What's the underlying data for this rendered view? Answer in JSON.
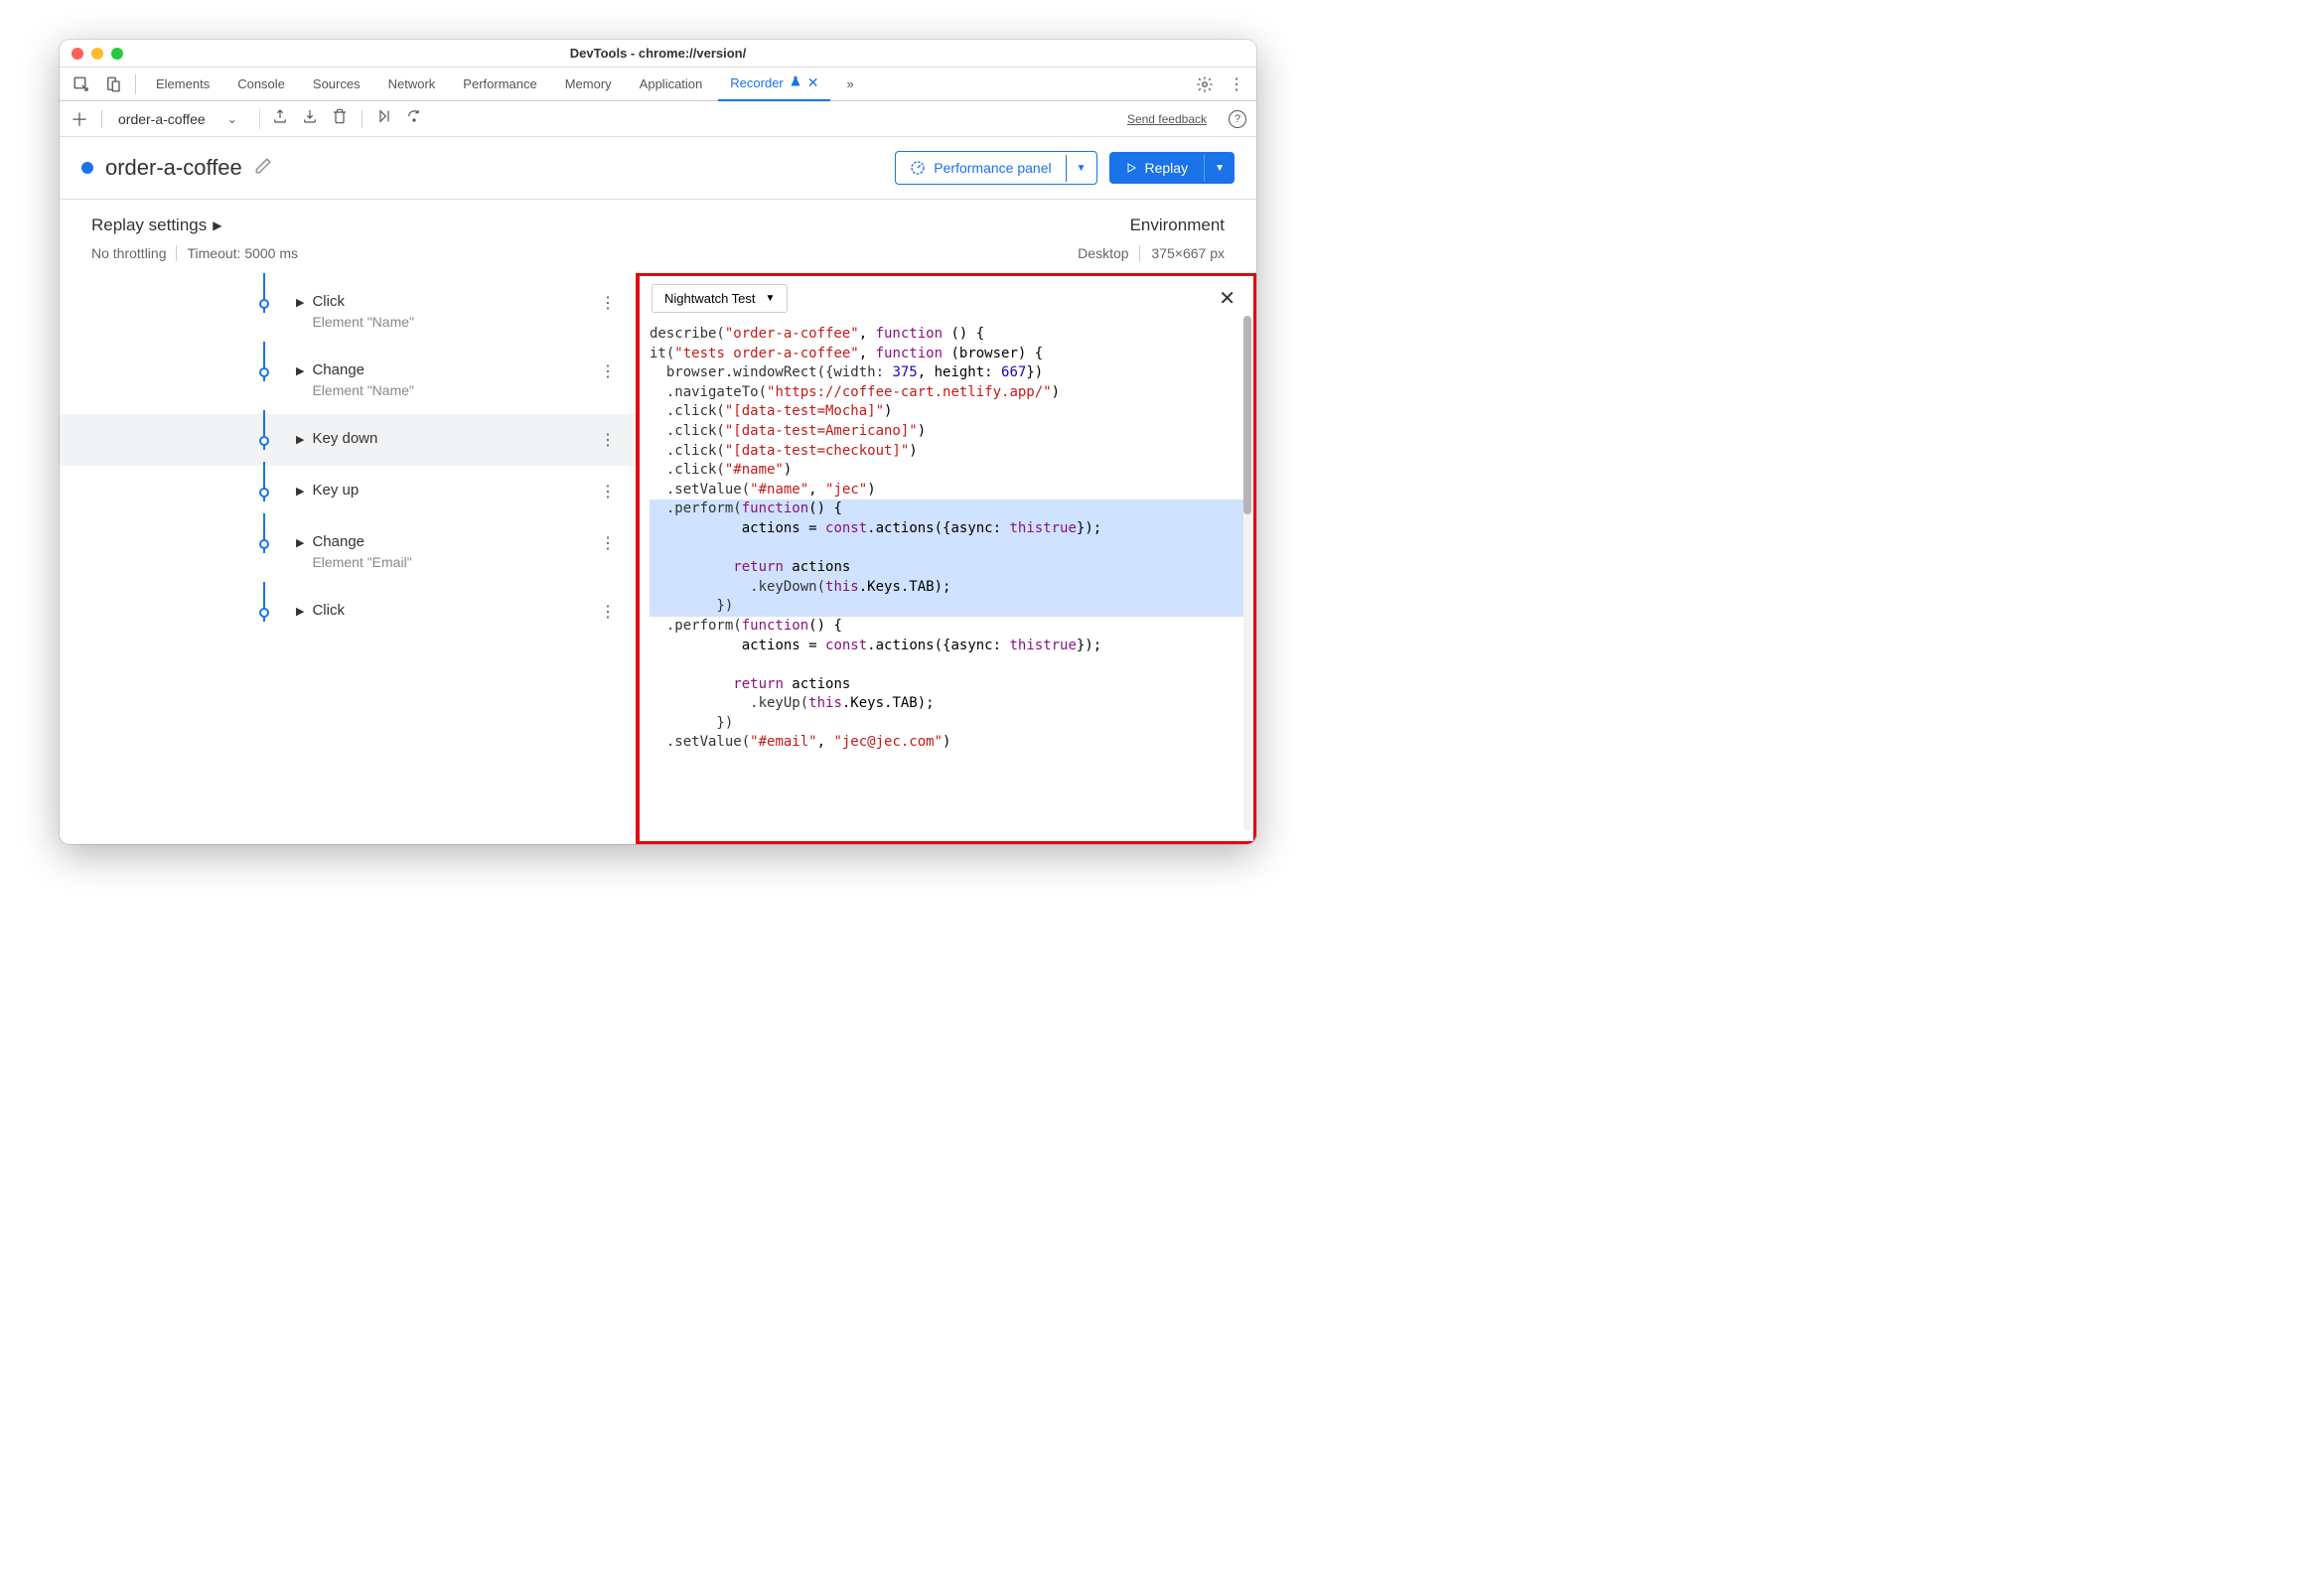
{
  "window": {
    "title": "DevTools - chrome://version/"
  },
  "tabs": {
    "items": [
      "Elements",
      "Console",
      "Sources",
      "Network",
      "Performance",
      "Memory",
      "Application",
      "Recorder"
    ],
    "active": "Recorder"
  },
  "toolbar": {
    "recording_name": "order-a-coffee",
    "feedback": "Send feedback"
  },
  "header": {
    "title": "order-a-coffee",
    "perf_button": "Performance panel",
    "replay_button": "Replay"
  },
  "settings": {
    "title": "Replay settings",
    "throttling": "No throttling",
    "timeout": "Timeout: 5000 ms",
    "env_title": "Environment",
    "env_device": "Desktop",
    "env_dims": "375×667 px"
  },
  "steps": [
    {
      "title": "Click",
      "sub": "Element \"Name\""
    },
    {
      "title": "Change",
      "sub": "Element \"Name\""
    },
    {
      "title": "Key down",
      "sub": ""
    },
    {
      "title": "Key up",
      "sub": ""
    },
    {
      "title": "Change",
      "sub": "Element \"Email\""
    },
    {
      "title": "Click",
      "sub": ""
    }
  ],
  "export": {
    "format": "Nightwatch Test"
  },
  "code": {
    "lines": [
      {
        "t": "describe(",
        "s": "\"order-a-coffee\"",
        "r": ", ",
        "k": "function",
        "e": " () {"
      },
      {
        "t": "it(",
        "s": "\"tests order-a-coffee\"",
        "r": ", ",
        "k": "function",
        "e": " (browser) {"
      },
      {
        "t": "  browser.windowRect({width: ",
        "n1": "375",
        "m": ", height: ",
        "n2": "667",
        "e": "})"
      },
      {
        "t": "  .navigateTo(",
        "s": "\"https://coffee-cart.netlify.app/\"",
        "e": ")"
      },
      {
        "t": "  .click(",
        "s": "\"[data-test=Mocha]\"",
        "e": ")"
      },
      {
        "t": "  .click(",
        "s": "\"[data-test=Americano]\"",
        "e": ")"
      },
      {
        "t": "  .click(",
        "s": "\"[data-test=checkout]\"",
        "e": ")"
      },
      {
        "t": "  .click(",
        "s": "\"#name\"",
        "e": ")"
      },
      {
        "t": "  .setValue(",
        "s": "\"#name\"",
        "m": ", ",
        "s2": "\"jec\"",
        "e": ")"
      },
      {
        "hl": true,
        "t": "  .perform(",
        "k": "function",
        "e": "() {"
      },
      {
        "hl": true,
        "t": "          ",
        "k": "const",
        "m": " actions = ",
        "k2": "this",
        "e": ".actions({async: ",
        "k3": "true",
        "e2": "});"
      },
      {
        "hl": true,
        "t": ""
      },
      {
        "hl": true,
        "t": "          ",
        "k": "return",
        "e": " actions"
      },
      {
        "hl": true,
        "t": "            .keyDown(",
        "k": "this",
        "e": ".Keys.TAB);"
      },
      {
        "hl": true,
        "t": "        })"
      },
      {
        "t": "  .perform(",
        "k": "function",
        "e": "() {"
      },
      {
        "t": "          ",
        "k": "const",
        "m": " actions = ",
        "k2": "this",
        "e": ".actions({async: ",
        "k3": "true",
        "e2": "});"
      },
      {
        "t": ""
      },
      {
        "t": "          ",
        "k": "return",
        "e": " actions"
      },
      {
        "t": "            .keyUp(",
        "k": "this",
        "e": ".Keys.TAB);"
      },
      {
        "t": "        })"
      },
      {
        "t": "  .setValue(",
        "s": "\"#email\"",
        "m": ", ",
        "s2": "\"jec@jec.com\"",
        "e": ")"
      }
    ]
  }
}
